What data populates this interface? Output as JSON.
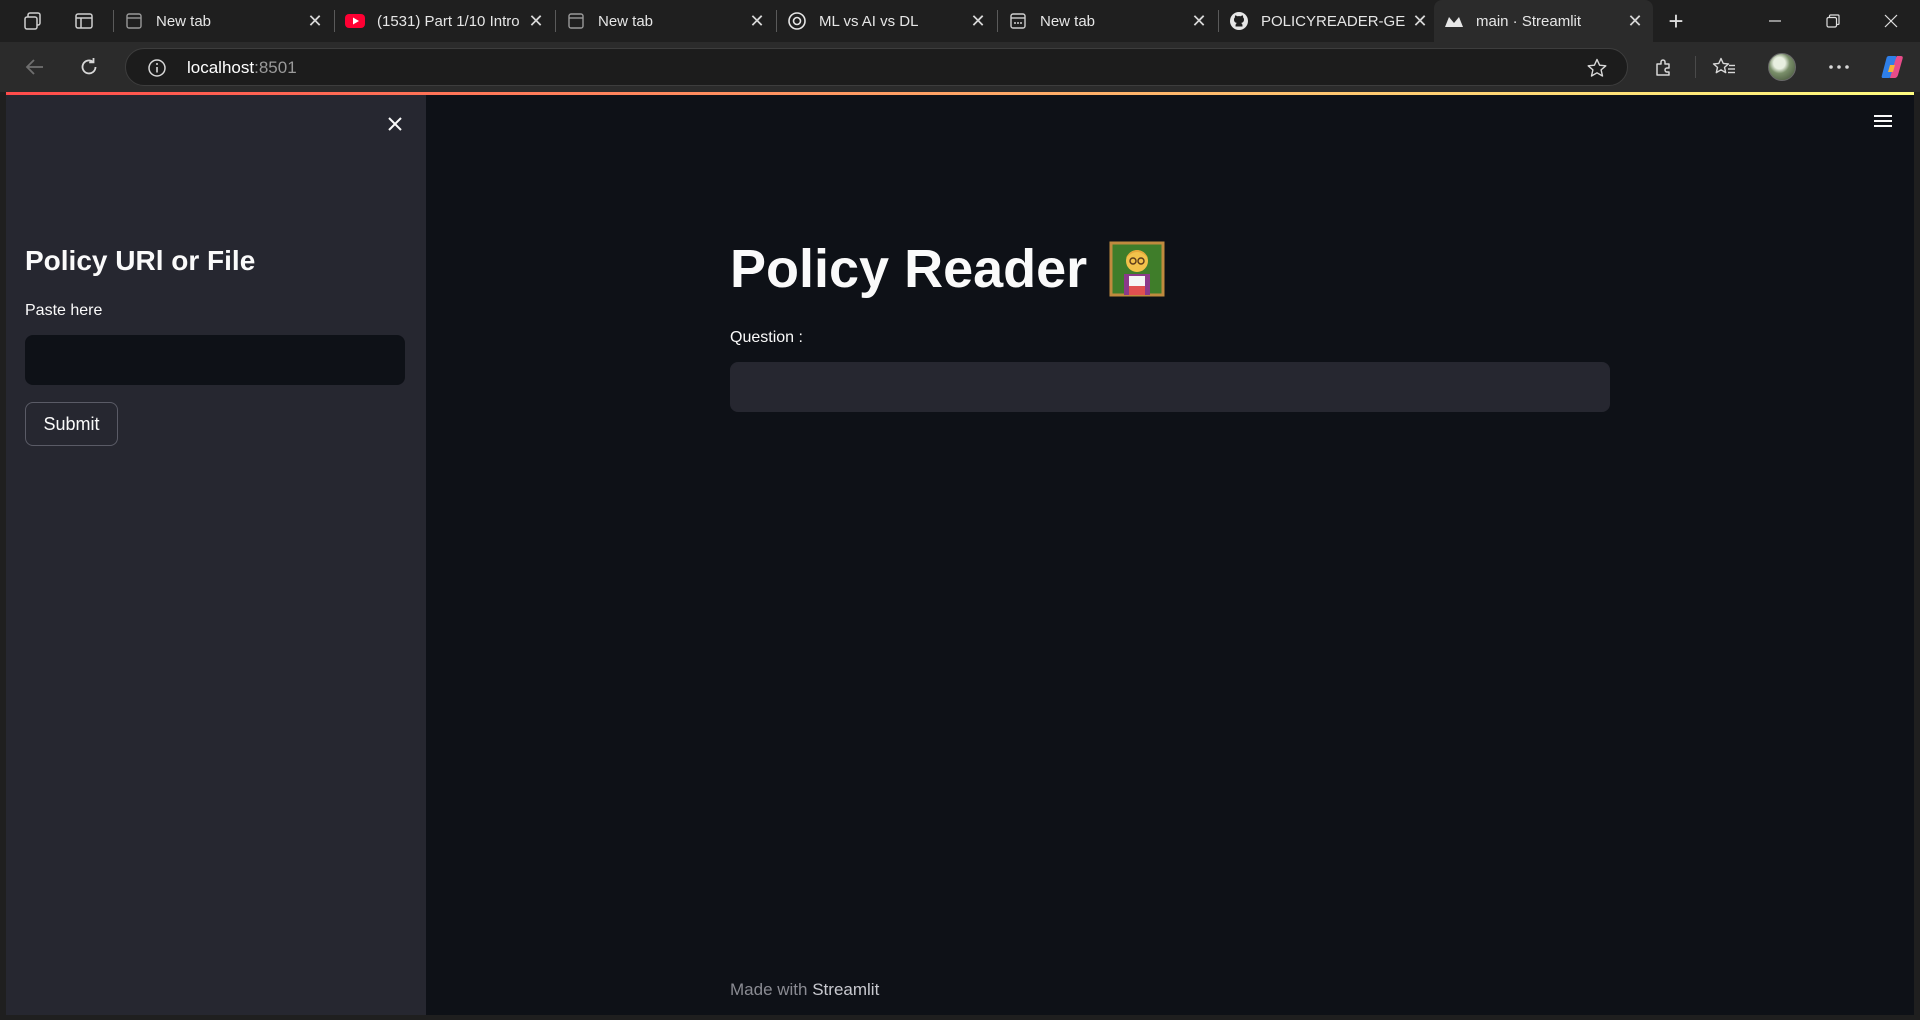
{
  "browser": {
    "tabs": [
      {
        "title": "New tab",
        "icon": "page-icon"
      },
      {
        "title": "(1531) Part 1/10 Intro",
        "icon": "youtube-icon"
      },
      {
        "title": "New tab",
        "icon": "page-icon"
      },
      {
        "title": "ML vs AI vs DL",
        "icon": "chatgpt-icon"
      },
      {
        "title": "New tab",
        "icon": "page-icon"
      },
      {
        "title": "POLICYREADER-GENAI",
        "icon": "github-icon"
      },
      {
        "title": "main · Streamlit",
        "icon": "streamlit-icon",
        "active": true
      }
    ],
    "address": {
      "host": "localhost",
      "port": ":8501"
    }
  },
  "colors": {
    "accent_gradient_start": "#ff4b4b",
    "accent_gradient_end": "#fffd80",
    "sidebar_bg": "#262730",
    "main_bg": "#0e1117"
  },
  "sidebar": {
    "title": "Policy URl or File",
    "input_label": "Paste here",
    "input_value": "",
    "submit_label": "Submit"
  },
  "main": {
    "title": "Policy Reader",
    "title_emoji": "teacher-emoji",
    "question_label": "Question :",
    "question_value": ""
  },
  "footer": {
    "prefix": "Made with",
    "brand": "Streamlit"
  }
}
